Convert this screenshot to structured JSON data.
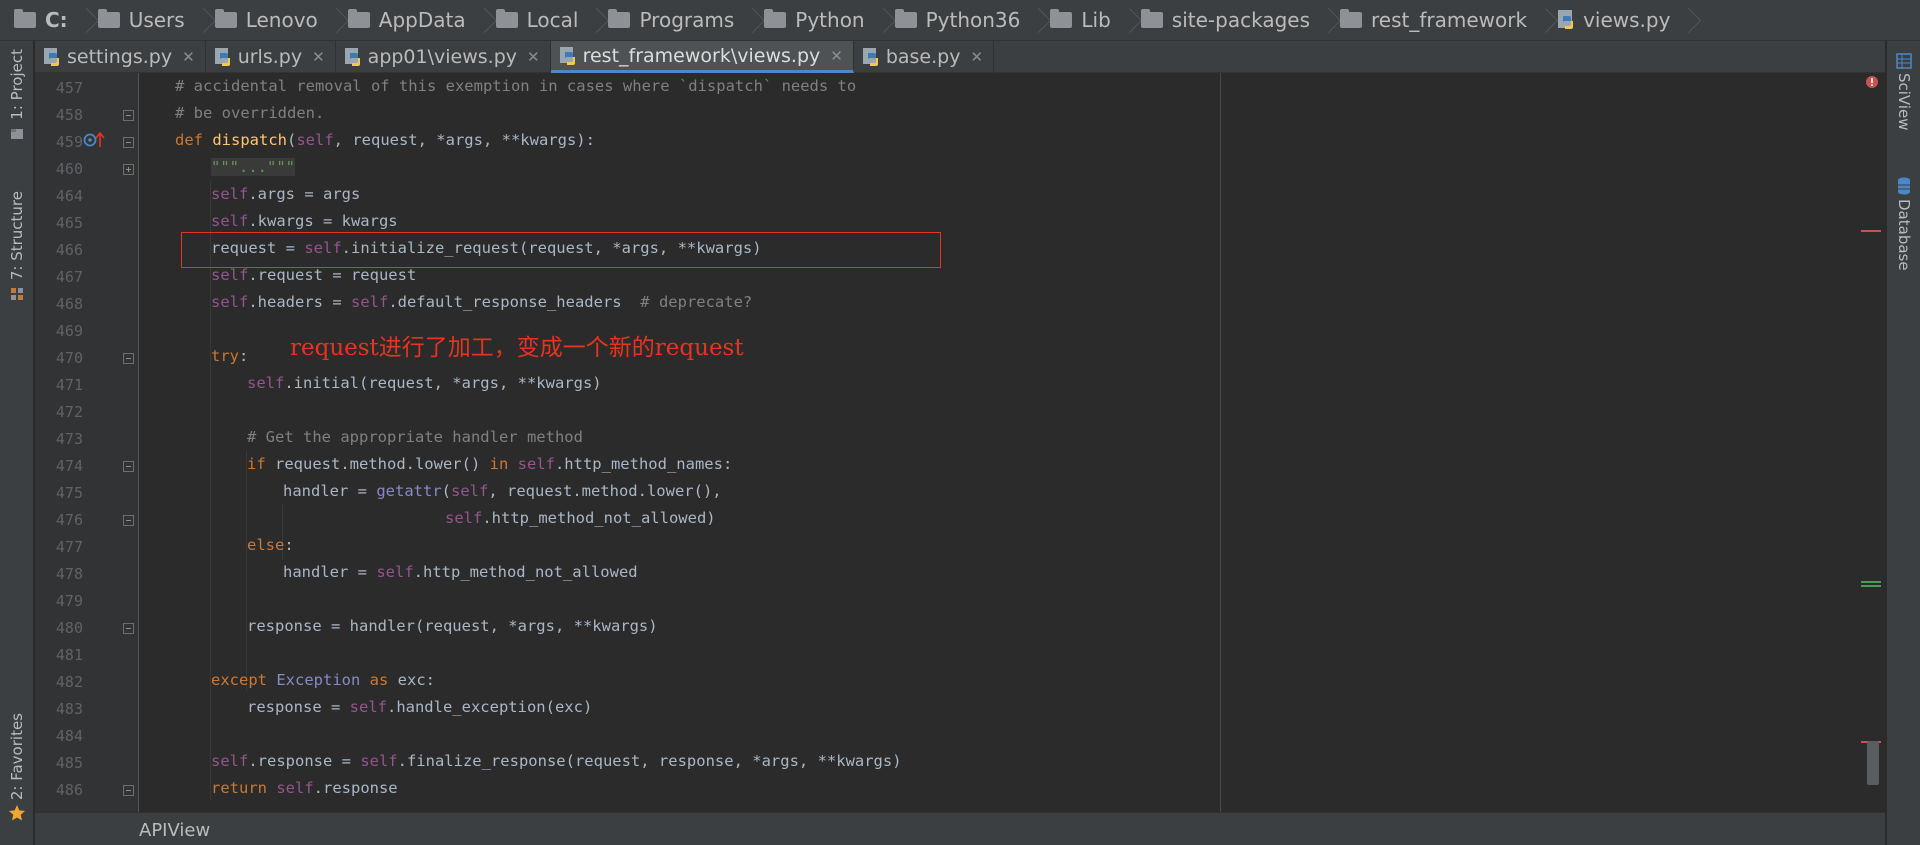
{
  "breadcrumb": [
    {
      "label": "C:",
      "type": "drive"
    },
    {
      "label": "Users",
      "type": "folder"
    },
    {
      "label": "Lenovo",
      "type": "folder"
    },
    {
      "label": "AppData",
      "type": "folder"
    },
    {
      "label": "Local",
      "type": "folder"
    },
    {
      "label": "Programs",
      "type": "folder"
    },
    {
      "label": "Python",
      "type": "folder"
    },
    {
      "label": "Python36",
      "type": "folder"
    },
    {
      "label": "Lib",
      "type": "folder"
    },
    {
      "label": "site-packages",
      "type": "folder"
    },
    {
      "label": "rest_framework",
      "type": "folder"
    },
    {
      "label": "views.py",
      "type": "file"
    }
  ],
  "tabs": [
    {
      "label": "settings.py",
      "active": false
    },
    {
      "label": "urls.py",
      "active": false
    },
    {
      "label": "app01\\views.py",
      "active": false
    },
    {
      "label": "rest_framework\\views.py",
      "active": true
    },
    {
      "label": "base.py",
      "active": false
    }
  ],
  "left_tools": {
    "project": "1: Project",
    "structure": "7: Structure",
    "favorites": "2: Favorites"
  },
  "right_tools": {
    "sciview": "SciView",
    "database": "Database"
  },
  "editor": {
    "line_numbers": [
      "457",
      "458",
      "459",
      "460",
      "464",
      "465",
      "466",
      "467",
      "468",
      "469",
      "470",
      "471",
      "472",
      "473",
      "474",
      "475",
      "476",
      "477",
      "478",
      "479",
      "480",
      "481",
      "482",
      "483",
      "484",
      "485",
      "486"
    ],
    "lines": {
      "l457": "# accidental removal of this exemption in cases where `dispatch` needs to",
      "l458": "# be overridden.",
      "l459_kw": "def ",
      "l459_fn": "dispatch",
      "l459_rest_a": "(",
      "l459_self": "self",
      "l459_rest_b": ", request, *args, **kwargs):",
      "l460": "\"\"\"...\"\"\"",
      "l464_self": "self",
      "l464_rest": ".args = args",
      "l465_self": "self",
      "l465_rest": ".kwargs = kwargs",
      "l466_a": "request = ",
      "l466_self": "self",
      "l466_b": ".initialize_request(request, *args, **kwargs)",
      "l467_self": "self",
      "l467_rest": ".request = request",
      "l468_self": "self",
      "l468_a": ".headers = ",
      "l468_self2": "self",
      "l468_b": ".default_response_headers  ",
      "l468_cm": "# deprecate?",
      "l470_kw": "try",
      "l470_rest": ":",
      "l471_self": "self",
      "l471_rest": ".initial(request, *args, **kwargs)",
      "l473": "# Get the appropriate handler method",
      "l474_kw": "if ",
      "l474_a": "request.method.lower() ",
      "l474_kw2": "in ",
      "l474_self": "self",
      "l474_b": ".http_method_names:",
      "l475_a": "handler = ",
      "l475_bi": "getattr",
      "l475_b": "(",
      "l475_self": "self",
      "l475_c": ", request.method.lower(),",
      "l476_self": "self",
      "l476_rest": ".http_method_not_allowed)",
      "l477_kw": "else",
      "l477_rest": ":",
      "l478_a": "handler = ",
      "l478_self": "self",
      "l478_b": ".http_method_not_allowed",
      "l480": "response = handler(request, *args, **kwargs)",
      "l482_kw": "except ",
      "l482_bi": "Exception ",
      "l482_kw2": "as ",
      "l482_rest": "exc:",
      "l483_a": "response = ",
      "l483_self": "self",
      "l483_b": ".handle_exception(exc)",
      "l485_self": "self",
      "l485_a": ".response = ",
      "l485_self2": "self",
      "l485_b": ".finalize_response(request, response, *args, **kwargs)",
      "l486_kw": "return ",
      "l486_self": "self",
      "l486_rest": ".response"
    }
  },
  "annotation": "request进行了加工，变成一个新的request",
  "status": {
    "context": "APIView"
  },
  "colors": {
    "annotation": "#e8331f",
    "keyword": "#cc7832",
    "self": "#94558d",
    "function": "#ffc66d",
    "comment": "#808080",
    "active_tab_underline": "#4a88c7"
  }
}
